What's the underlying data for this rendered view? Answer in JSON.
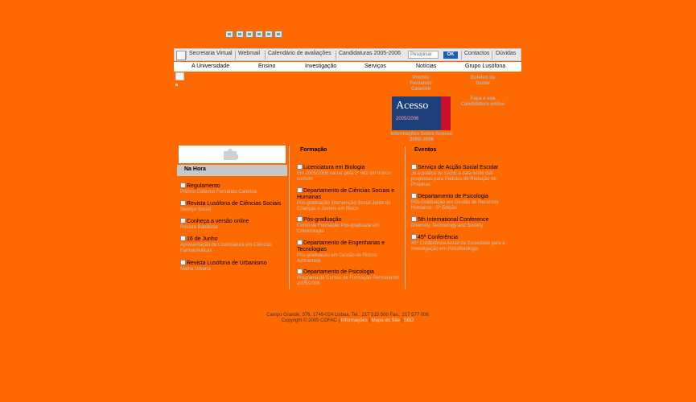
{
  "top_icons": [
    "flag-icon",
    "flag-icon",
    "flag-icon",
    "flag-icon",
    "flag-icon",
    "flag-icon"
  ],
  "topbar": {
    "links": [
      "Secretaria Virtual",
      "Webmail",
      "Calendário de avaliações",
      "Candidaturas 2005-2006"
    ],
    "search_placeholder": "Pesquisar",
    "ok_label": "OK",
    "contacts": "Contactos",
    "doubts": "Dúvidas"
  },
  "navbar": [
    "A Universidade",
    "Ensino",
    "Investigação",
    "Serviços",
    "Notícias",
    "Grupo Lusófona"
  ],
  "promo": {
    "premio": "Prémio Fernando Caterino",
    "boletim": "Boletim da Saúde",
    "candidatura": "Faça a sua Candidatura online",
    "acesso_title": "Acesso",
    "acesso_year": "2005/2006",
    "acesso_info": "Informações Sobre Acesso 2005/ 2006"
  },
  "na_hora": {
    "heading": "Na Hora",
    "items": [
      {
        "title": "Regulamento",
        "sub": "Prémio Caterino Fernando Caterino"
      },
      {
        "title": "Revista Lusófona de Ciências Sociais",
        "sub": "Serviço Social"
      },
      {
        "title": "Conheça a versão online",
        "sub": "Revista Babilónia"
      },
      {
        "title": "16 de Junho",
        "sub": "Apresentação da Licenciatura em Ciências Farmacêuticas"
      },
      {
        "title": "Revista Lusófona de Urbanismo",
        "sub": "Malha Urbana"
      }
    ]
  },
  "formacao": {
    "heading": "Formação",
    "items": [
      {
        "title": "Licenciatura em Biologia",
        "sub": "Em 2005/2006 vai ter pela 1ª vez um tronco comum"
      },
      {
        "title": "Departamento de Ciências Sociais e Humanas",
        "sub": "Pós-graduação Intervenção Social Junto de Crianças e Jovens em Risco"
      },
      {
        "title": "Pós-graduação",
        "sub": "Curso de Formação Pós-graduada em Criminologia"
      },
      {
        "title": "Departamento de Engenharias e Tecnologias",
        "sub": "Pós-graduação em Gestão de Riscos Ambientais"
      },
      {
        "title": "Departamento de Psicologia",
        "sub": "Programa de Cursos de Formação Permanente 2005/2006"
      }
    ]
  },
  "eventos": {
    "heading": "Eventos",
    "items": [
      {
        "title": "Serviço de Acção Social Escolar",
        "sub": "Já à prática os SASE a data limite das propostas para Pedidos de Redução de Propinas"
      },
      {
        "title": "Departamento de Psicologia",
        "sub": "Pós-Graduação em Gestão de Recursos Humanos - 5ª Edição"
      },
      {
        "title": "5th International Conference",
        "sub": "Diversity, Technology and Society"
      },
      {
        "title": "45ª Conferência",
        "sub": "45ª Conferência Anual da Sociedade para a Investigação em Psicofisiologia"
      }
    ]
  },
  "footer": {
    "address": "Campo Grande, 376, 1749-024 Lisboa, Tel.: 217 515 500 Fax.: 217 577 006",
    "copyright": "Copyright © 2005 COFAC |",
    "links": [
      "Informações",
      "Mapa do Site",
      "SBD"
    ]
  }
}
